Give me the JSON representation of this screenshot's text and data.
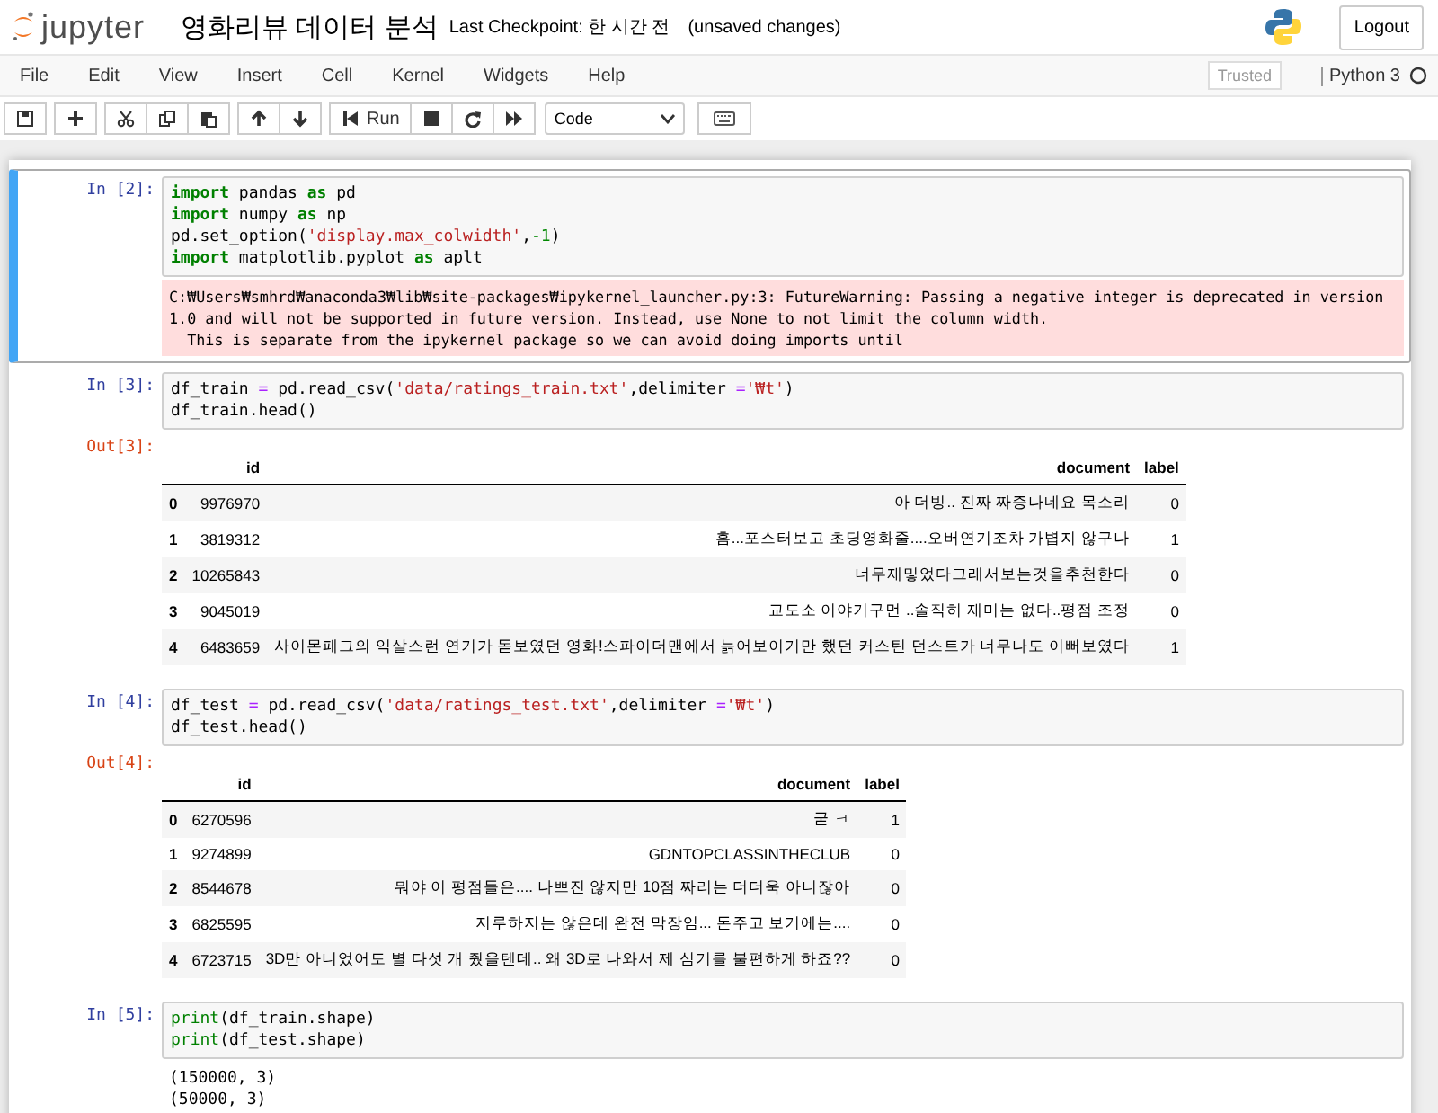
{
  "header": {
    "logo_text": "jupyter",
    "notebook_title": "영화리뷰 데이터 분석",
    "checkpoint": "Last Checkpoint: 한 시간 전",
    "save_status": "(unsaved changes)",
    "logout": "Logout"
  },
  "menu": {
    "items": [
      "File",
      "Edit",
      "View",
      "Insert",
      "Cell",
      "Kernel",
      "Widgets",
      "Help"
    ],
    "trusted": "Trusted",
    "kernel_name": "Python 3"
  },
  "toolbar": {
    "groups": [
      [
        {
          "kind": "save"
        }
      ],
      [
        {
          "kind": "add"
        }
      ],
      [
        {
          "kind": "cut"
        },
        {
          "kind": "copy"
        },
        {
          "kind": "paste"
        }
      ],
      [
        {
          "kind": "up"
        },
        {
          "kind": "down"
        }
      ],
      [
        {
          "kind": "run",
          "label": "Run"
        },
        {
          "kind": "stop"
        },
        {
          "kind": "restart"
        },
        {
          "kind": "fast-forward"
        }
      ]
    ],
    "cell_type": "Code"
  },
  "cells": [
    {
      "prompt": "In [2]:",
      "selected": true,
      "code": [
        [
          {
            "kind": "kw",
            "text": "import"
          },
          {
            "kind": "p",
            "text": " pandas "
          },
          {
            "kind": "kw",
            "text": "as"
          },
          {
            "kind": "p",
            "text": " pd"
          }
        ],
        [
          {
            "kind": "kw",
            "text": "import"
          },
          {
            "kind": "p",
            "text": " numpy "
          },
          {
            "kind": "kw",
            "text": "as"
          },
          {
            "kind": "p",
            "text": " np"
          }
        ],
        [
          {
            "kind": "p",
            "text": "pd.set_option("
          },
          {
            "kind": "str",
            "text": "'display.max_colwidth'"
          },
          {
            "kind": "p",
            "text": ","
          },
          {
            "kind": "num",
            "text": "-1"
          },
          {
            "kind": "p",
            "text": ")"
          }
        ],
        [
          {
            "kind": "kw",
            "text": "import"
          },
          {
            "kind": "p",
            "text": " matplotlib.pyplot "
          },
          {
            "kind": "kw",
            "text": "as"
          },
          {
            "kind": "p",
            "text": " aplt"
          }
        ]
      ],
      "outputs": [
        {
          "kind": "stderr",
          "lines": [
            "C:₩Users₩smhrd₩anaconda3₩lib₩site-packages₩ipykernel_launcher.py:3: FutureWarning: Passing a negative integer is deprecated in version",
            "1.0 and will not be supported in future version. Instead, use None to not limit the column width.",
            "  This is separate from the ipykernel package so we can avoid doing imports until"
          ]
        }
      ]
    },
    {
      "prompt": "In [3]:",
      "selected": false,
      "code": [
        [
          {
            "kind": "p",
            "text": "df_train "
          },
          {
            "kind": "op",
            "text": "="
          },
          {
            "kind": "p",
            "text": " pd.read_csv("
          },
          {
            "kind": "str",
            "text": "'data/ratings_train.txt'"
          },
          {
            "kind": "p",
            "text": ",delimiter "
          },
          {
            "kind": "op",
            "text": "="
          },
          {
            "kind": "str",
            "text": "'₩t'"
          },
          {
            "kind": "p",
            "text": ")"
          }
        ],
        [
          {
            "kind": "p",
            "text": "df_train.head()"
          }
        ]
      ],
      "outputs": [
        {
          "kind": "table",
          "prompt": "Out[3]:",
          "columns": [
            "",
            "id",
            "document",
            "label"
          ],
          "rows": [
            [
              "0",
              "9976970",
              "아 더빙.. 진짜 짜증나네요 목소리",
              "0"
            ],
            [
              "1",
              "3819312",
              "흠...포스터보고 초딩영화줄....오버연기조차 가볍지 않구나",
              "1"
            ],
            [
              "2",
              "10265843",
              "너무재밓었다그래서보는것을추천한다",
              "0"
            ],
            [
              "3",
              "9045019",
              "교도소 이야기구먼 ..솔직히 재미는 없다..평점 조정",
              "0"
            ],
            [
              "4",
              "6483659",
              "사이몬페그의 익살스런 연기가 돋보였던 영화!스파이더맨에서 늙어보이기만 했던 커스틴 던스트가 너무나도 이뻐보였다",
              "1"
            ]
          ]
        }
      ]
    },
    {
      "prompt": "In [4]:",
      "selected": false,
      "code": [
        [
          {
            "kind": "p",
            "text": "df_test "
          },
          {
            "kind": "op",
            "text": "="
          },
          {
            "kind": "p",
            "text": " pd.read_csv("
          },
          {
            "kind": "str",
            "text": "'data/ratings_test.txt'"
          },
          {
            "kind": "p",
            "text": ",delimiter "
          },
          {
            "kind": "op",
            "text": "="
          },
          {
            "kind": "str",
            "text": "'₩t'"
          },
          {
            "kind": "p",
            "text": ")"
          }
        ],
        [
          {
            "kind": "p",
            "text": "df_test.head()"
          }
        ]
      ],
      "outputs": [
        {
          "kind": "table",
          "prompt": "Out[4]:",
          "columns": [
            "",
            "id",
            "document",
            "label"
          ],
          "rows": [
            [
              "0",
              "6270596",
              "굳 ㅋ",
              "1"
            ],
            [
              "1",
              "9274899",
              "GDNTOPCLASSINTHECLUB",
              "0"
            ],
            [
              "2",
              "8544678",
              "뭐야 이 평점들은.... 나쁘진 않지만 10점 짜리는 더더욱 아니잖아",
              "0"
            ],
            [
              "3",
              "6825595",
              "지루하지는 않은데 완전 막장임... 돈주고 보기에는....",
              "0"
            ],
            [
              "4",
              "6723715",
              "3D만 아니었어도 별 다섯 개 줬을텐데.. 왜 3D로 나와서 제 심기를 불편하게 하죠??",
              "0"
            ]
          ]
        }
      ]
    },
    {
      "prompt": "In [5]:",
      "selected": false,
      "code": [
        [
          {
            "kind": "kw2",
            "text": "print"
          },
          {
            "kind": "p",
            "text": "(df_train.shape)"
          }
        ],
        [
          {
            "kind": "kw2",
            "text": "print"
          },
          {
            "kind": "p",
            "text": "(df_test.shape)"
          }
        ]
      ],
      "outputs": [
        {
          "kind": "stream",
          "lines": [
            "(150000, 3)",
            "(50000, 3)"
          ]
        }
      ]
    }
  ]
}
